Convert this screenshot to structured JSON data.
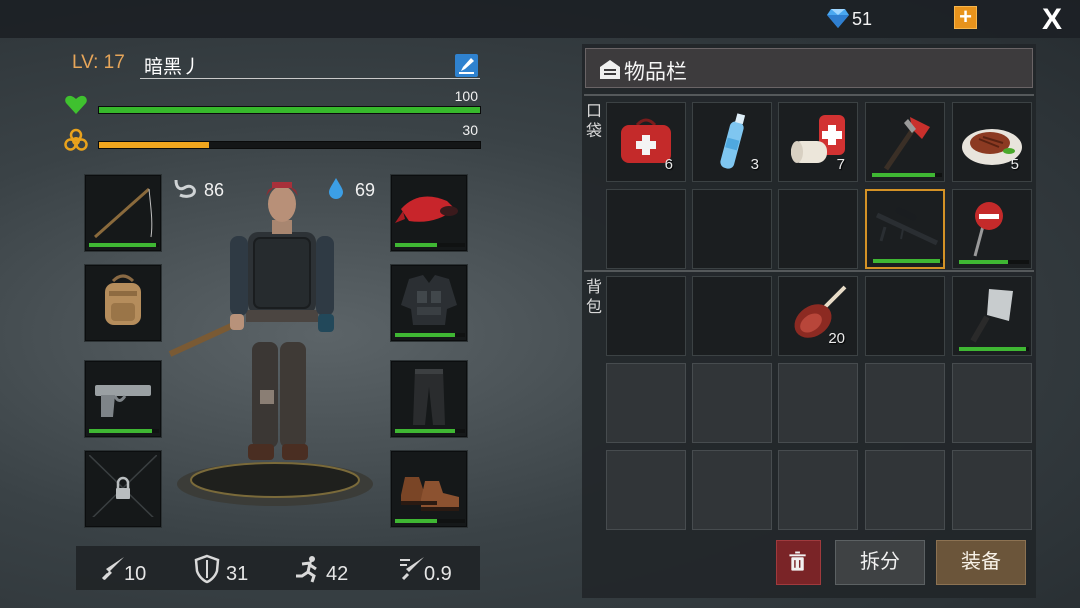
{
  "top_bar": {
    "gems": "51",
    "gem_icon": "diamond-icon",
    "add_icon": "plus-icon",
    "close_label": "X"
  },
  "player": {
    "level_label": "LV: 17",
    "name": "暗黑丿",
    "health": {
      "value": "100",
      "fraction": 1.0,
      "color": "#37b92c"
    },
    "radiation": {
      "value": "30",
      "fraction": 0.29,
      "color": "#f1a61e"
    },
    "hunger": "86",
    "thirst": "69"
  },
  "equipment": {
    "left": [
      {
        "slot": "weapon",
        "icon": "fishing-rod-icon",
        "durability": 0.95
      },
      {
        "slot": "bag",
        "icon": "backpack-icon",
        "durability": null
      },
      {
        "slot": "sidearm",
        "icon": "pistol-icon",
        "durability": 0.9
      },
      {
        "slot": "locked",
        "icon": "lock-icon",
        "durability": null
      }
    ],
    "right": [
      {
        "slot": "head",
        "icon": "bandana-icon",
        "durability": 0.6
      },
      {
        "slot": "body",
        "icon": "tactical-vest-icon",
        "durability": 0.85
      },
      {
        "slot": "legs",
        "icon": "pants-icon",
        "durability": 0.85
      },
      {
        "slot": "feet",
        "icon": "boots-icon",
        "durability": 0.6
      }
    ]
  },
  "stats": {
    "attack": "10",
    "defense": "31",
    "speed": "42",
    "attack_speed": "0.9"
  },
  "inventory": {
    "title": "物品栏",
    "pockets_label": "口\n袋",
    "backpack_label": "背\n包",
    "pockets_row1": [
      {
        "item": "first-aid-kit",
        "count": "6"
      },
      {
        "item": "water-bottle",
        "count": "3"
      },
      {
        "item": "bandage",
        "count": "7"
      },
      {
        "item": "fire-axe",
        "count": "",
        "durability": 0.9
      },
      {
        "item": "steak",
        "count": "5"
      }
    ],
    "pockets_row2": [
      {
        "item": ""
      },
      {
        "item": ""
      },
      {
        "item": ""
      },
      {
        "item": "sniper-rifle",
        "count": "",
        "durability": 0.95,
        "selected": true
      },
      {
        "item": "stop-sign",
        "count": "",
        "durability": 0.7
      }
    ],
    "backpack_row1": [
      {
        "item": ""
      },
      {
        "item": ""
      },
      {
        "item": "ham-leg",
        "count": "20"
      },
      {
        "item": ""
      },
      {
        "item": "cleaver",
        "count": "",
        "durability": 0.95
      }
    ]
  },
  "actions": {
    "delete_icon": "trash-icon",
    "split": "拆分",
    "equip": "装备"
  }
}
